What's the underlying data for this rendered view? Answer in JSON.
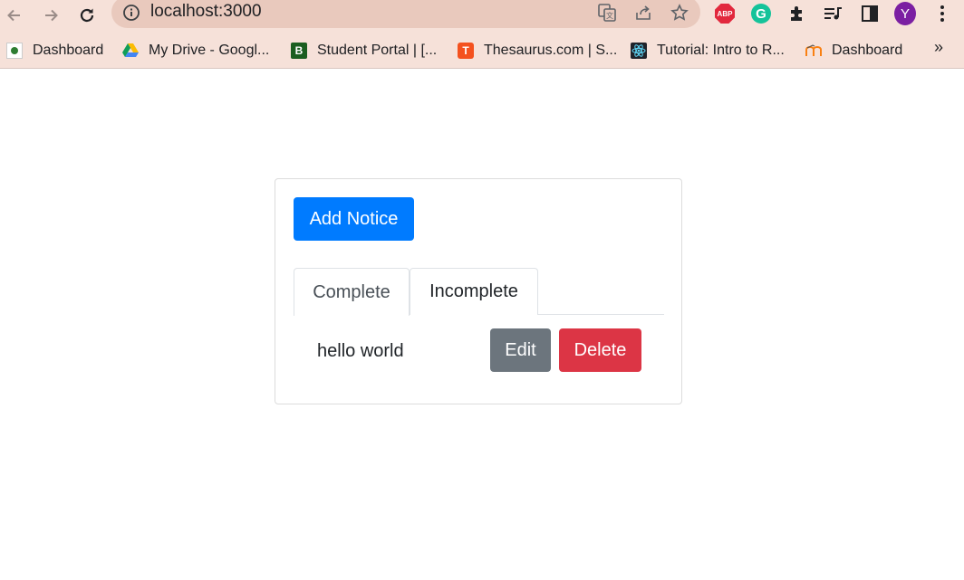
{
  "browser": {
    "url": "localhost:3000",
    "avatar_letter": "Y",
    "bookmarks": [
      {
        "label": "Dashboard",
        "icon": "dashboard-favicon"
      },
      {
        "label": "My Drive - Googl...",
        "icon": "google-drive-icon"
      },
      {
        "label": "Student Portal | [...",
        "icon": "student-portal-favicon"
      },
      {
        "label": "Thesaurus.com | S...",
        "icon": "thesaurus-favicon"
      },
      {
        "label": "Tutorial: Intro to R...",
        "icon": "react-icon"
      },
      {
        "label": "Dashboard",
        "icon": "moodle-favicon"
      }
    ],
    "more_label": "»",
    "extensions": {
      "abp": "ABP",
      "grammarly": "G"
    }
  },
  "app": {
    "add_button_label": "Add Notice",
    "tabs": [
      {
        "label": "Complete",
        "active": true
      },
      {
        "label": "Incomplete",
        "active": false
      }
    ],
    "notices": [
      {
        "text": "hello world",
        "edit_label": "Edit",
        "delete_label": "Delete"
      }
    ]
  },
  "colors": {
    "primary": "#007bff",
    "secondary": "#6c757d",
    "danger": "#dc3545",
    "chrome": "#f6e1d9"
  }
}
